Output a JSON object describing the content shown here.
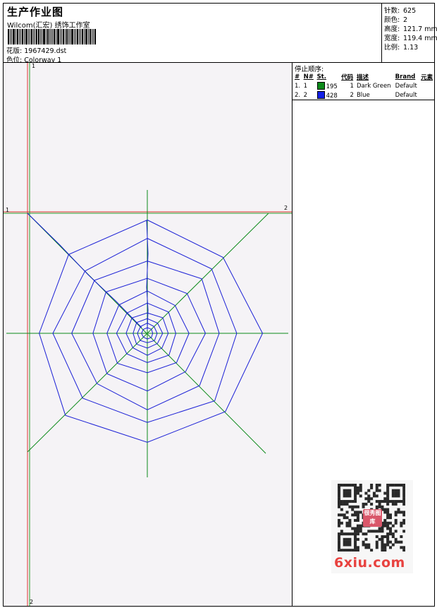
{
  "header": {
    "title": "生产作业图",
    "company": "Wilcom(汇宏) 绣饰工作室",
    "design_label": "花版:",
    "design_value": "1967429.dst",
    "colorway_label": "色位:",
    "colorway_value": "Colorway 1"
  },
  "specs": [
    {
      "label": "针数:",
      "value": "625"
    },
    {
      "label": "颜色:",
      "value": "2"
    },
    {
      "label": "高度:",
      "value": "121.7 mm"
    },
    {
      "label": "宽度:",
      "value": "119.4 mm"
    },
    {
      "label": "比例:",
      "value": "1.13"
    }
  ],
  "stop_sequence": {
    "title": "停止顺序:",
    "columns": [
      "#",
      "N#",
      "St.",
      "代码",
      "描述",
      "Brand",
      "元素"
    ],
    "rows": [
      {
        "seq": "1.",
        "needle": "1",
        "stitches": "195",
        "code": "1",
        "description": "Dark Green",
        "brand": "Default",
        "color": "#0c8a1a"
      },
      {
        "seq": "2.",
        "needle": "2",
        "stitches": "428",
        "code": "2",
        "description": "Blue",
        "brand": "Default",
        "color": "#1320e6"
      }
    ]
  },
  "guides": {
    "left_top": "1",
    "left_bottom": "2",
    "top_left": "1",
    "top_right": "2"
  },
  "colors": {
    "thread_green": "#0c8a1a",
    "thread_blue": "#1a1fd6",
    "guide_red": "#e03030",
    "guide_green": "#2a9a2a",
    "canvas": "#f5f3f6"
  },
  "watermark": {
    "site": "6xiu.com",
    "stamp": "很秀图库"
  }
}
